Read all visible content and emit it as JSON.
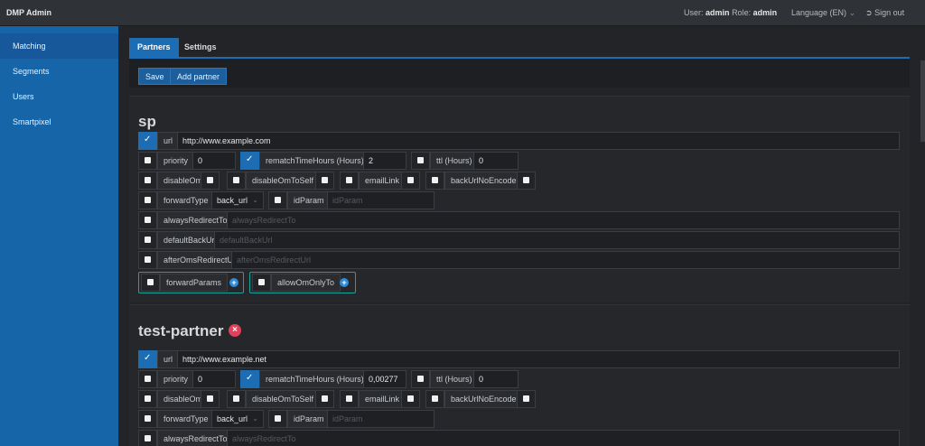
{
  "app": {
    "title": "DMP Admin"
  },
  "header": {
    "user_label": "User:",
    "user": "admin",
    "role_label": "Role:",
    "role": "admin",
    "language": "Language (EN)",
    "signout": "Sign out"
  },
  "sidebar": {
    "items": [
      {
        "label": "Matching"
      },
      {
        "label": "Segments"
      },
      {
        "label": "Users"
      },
      {
        "label": "Smartpixel"
      }
    ]
  },
  "tabs": [
    {
      "label": "Partners"
    },
    {
      "label": "Settings"
    }
  ],
  "toolbar": {
    "save": "Save",
    "add": "Add partner"
  },
  "partners": [
    {
      "name": "sp",
      "url": "http://www.example.com",
      "priority": "0",
      "rematch": "2",
      "ttl": "0",
      "forward_type": "back_url",
      "checked": {
        "url": true,
        "rematch": true
      }
    },
    {
      "name": "test-partner",
      "url": "http://www.example.net",
      "priority": "0",
      "rematch": "0,00277",
      "ttl": "0",
      "forward_type": "back_url",
      "checked": {
        "url": true,
        "rematch": true
      }
    }
  ],
  "labels": {
    "url": "url",
    "priority": "priority",
    "rematch": "rematchTimeHours (Hours)",
    "ttl": "ttl (Hours)",
    "disableOm": "disableOm",
    "disableOmToSelf": "disableOmToSelf",
    "emailLink": "emailLink",
    "backUrlNoEncode": "backUrlNoEncode",
    "forwardType": "forwardType",
    "idParam": "idParam",
    "alwaysRedirectTo": "alwaysRedirectTo",
    "defaultBackUrl": "defaultBackUrl",
    "afterOmsRedirectUrl": "afterOmsRedirectUrl",
    "forwardParams": "forwardParams",
    "allowOmOnlyTo": "allowOmOnlyTo"
  },
  "placeholders": {
    "idParam": "idParam",
    "alwaysRedirectTo": "alwaysRedirectTo",
    "defaultBackUrl": "defaultBackUrl",
    "afterOmsRedirectUrl": "afterOmsRedirectUrl"
  },
  "icons": {
    "signout": "signout-icon",
    "chevron": "chevron-down-icon",
    "add": "plus-icon",
    "delete": "delete-icon"
  }
}
